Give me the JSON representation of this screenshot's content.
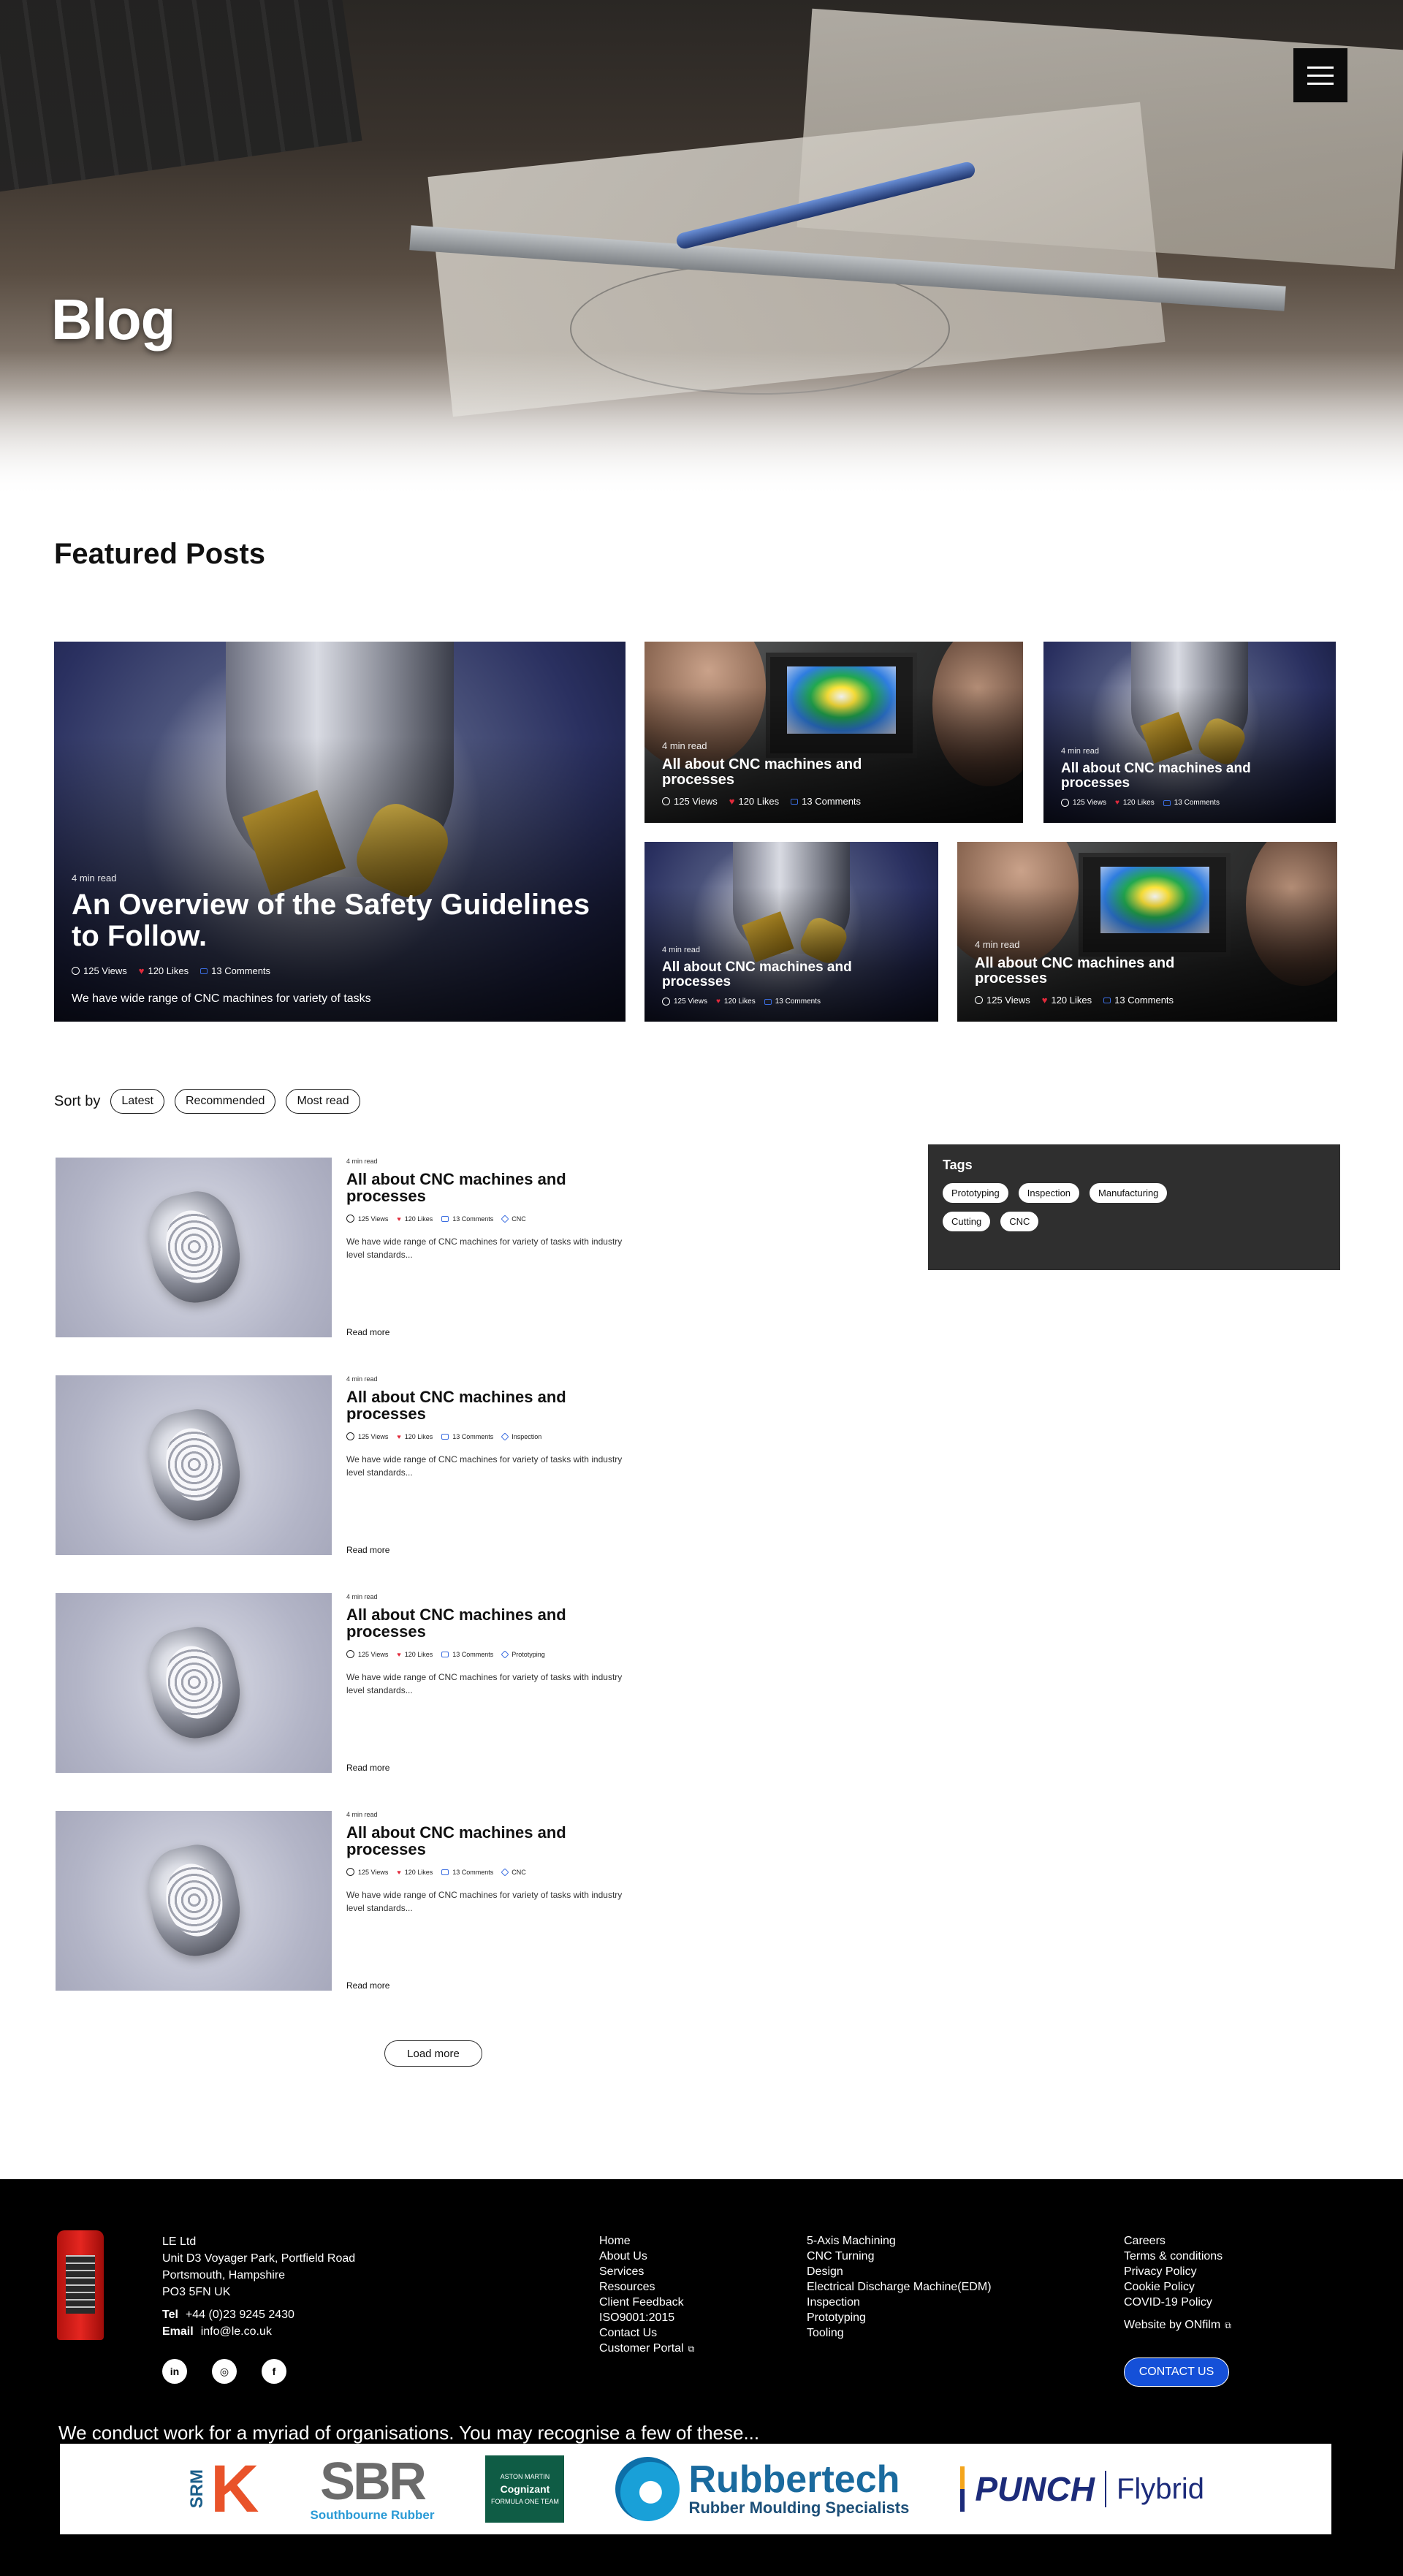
{
  "hero": {
    "title": "Blog"
  },
  "featured": {
    "title": "Featured Posts",
    "main": {
      "read_time": "4 min read",
      "title": "An Overview of the Safety Guidelines to Follow.",
      "views": "125 Views",
      "likes": "120 Likes",
      "comments": "13 Comments",
      "excerpt": "We have  wide range of CNC machines for variety of tasks"
    },
    "cards": [
      {
        "read_time": "4 min read",
        "title": "All about CNC machines and processes",
        "views": "125 Views",
        "likes": "120 Likes",
        "comments": "13 Comments"
      },
      {
        "read_time": "4 min read",
        "title": "All about CNC machines and processes",
        "views": "125 Views",
        "likes": "120 Likes",
        "comments": "13 Comments"
      },
      {
        "read_time": "4 min read",
        "title": "All about CNC machines and processes",
        "views": "125 Views",
        "likes": "120 Likes",
        "comments": "13 Comments"
      },
      {
        "read_time": "4 min read",
        "title": "All about CNC machines and processes",
        "views": "125 Views",
        "likes": "120 Likes",
        "comments": "13 Comments"
      }
    ]
  },
  "sort": {
    "label": "Sort by",
    "options": [
      "Latest",
      "Recommended",
      "Most read"
    ]
  },
  "posts": [
    {
      "read_time": "4 min read",
      "title": "All about CNC machines and processes",
      "views": "125 Views",
      "likes": "120 Likes",
      "comments": "13 Comments",
      "tag": "CNC",
      "excerpt": "We have  wide range of CNC machines for variety of tasks with industry level standards...",
      "read_more": "Read more"
    },
    {
      "read_time": "4 min read",
      "title": "All about CNC machines and processes",
      "views": "125 Views",
      "likes": "120 Likes",
      "comments": "13 Comments",
      "tag": "Inspection",
      "excerpt": "We have  wide range of CNC machines for variety of tasks with industry level standards...",
      "read_more": "Read more"
    },
    {
      "read_time": "4 min read",
      "title": "All about CNC machines and processes",
      "views": "125 Views",
      "likes": "120 Likes",
      "comments": "13 Comments",
      "tag": "Prototyping",
      "excerpt": "We have  wide range of CNC machines for variety of tasks with industry level standards...",
      "read_more": "Read more"
    },
    {
      "read_time": "4 min read",
      "title": "All about CNC machines and processes",
      "views": "125 Views",
      "likes": "120 Likes",
      "comments": "13 Comments",
      "tag": "CNC",
      "excerpt": "We have  wide range of CNC machines for variety of tasks with industry level standards...",
      "read_more": "Read more"
    }
  ],
  "tags": {
    "title": "Tags",
    "items": [
      "Prototyping",
      "Inspection",
      "Manufacturing",
      "Cutting",
      "CNC"
    ]
  },
  "load_more": "Load more",
  "footer": {
    "company": "LE Ltd",
    "address": [
      "Unit D3 Voyager Park, Portfield Road",
      "Portsmouth, Hampshire",
      "PO3 5FN UK"
    ],
    "tel_label": "Tel",
    "tel": "+44 (0)23 9245 2430",
    "email_label": "Email",
    "email": "info@le.co.uk",
    "social": [
      "in",
      "◎",
      "f"
    ],
    "nav": [
      "Home",
      "About Us",
      "Services",
      "Resources",
      "Client Feedback",
      "ISO9001:2015",
      "Contact Us",
      "Customer Portal"
    ],
    "services": [
      "5-Axis Machining",
      "CNC Turning",
      "Design",
      "Electrical Discharge Machine(EDM)",
      "Inspection",
      "Prototyping",
      "Tooling"
    ],
    "legal": [
      "Careers",
      "Terms & conditions",
      "Privacy Policy",
      "Cookie Policy",
      "COVID-19 Policy"
    ],
    "credit": "Website by ONfilm",
    "cta": "CONTACT US",
    "orgs_line": "We conduct work for a myriad of organisations. You may recognise a few of these...",
    "logos": {
      "srm": "SRM",
      "sbr": "SBR",
      "sbr_sub": "Southbourne Rubber",
      "aston": "ASTON MARTIN",
      "cognizant": "Cognizant",
      "aston_sub": "FORMULA ONE TEAM",
      "rubbertech": "Rubbertech",
      "rubbertech_sub": "Rubber Moulding Specialists",
      "punch": "PUNCH",
      "flybrid": "Flybrid"
    }
  }
}
